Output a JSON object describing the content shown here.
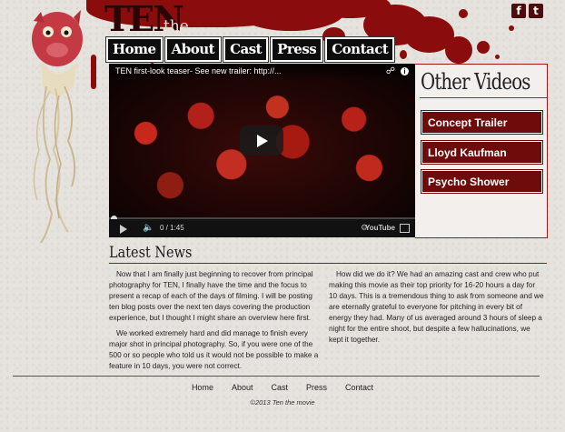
{
  "logo": {
    "ten": "TEN",
    "subtitle": "the movie"
  },
  "social": {
    "facebook": "f",
    "twitter": "t"
  },
  "nav": [
    "Home",
    "About",
    "Cast",
    "Press",
    "Contact"
  ],
  "video": {
    "title": "TEN first-look teaser- See new trailer: http://...",
    "time": "0 / 1:45",
    "logo": "YouTube"
  },
  "other_videos": {
    "heading": "Other Videos",
    "items": [
      "Concept Trailer",
      "Lloyd Kaufman",
      "Psycho Shower"
    ]
  },
  "news": {
    "heading": "Latest News",
    "left": [
      "Now that I am finally just beginning to recover from principal photography for TEN, I finally have the time and the focus to present a recap of each of the days of filming. I will be posting ten blog posts over the next ten days covering the production experience, but I thought I might share an overview here first.",
      "We worked extremely hard and did manage to finish every major shot in principal photography. So, if you were one of the 500 or so people who told us it would not be possible to make a feature in 10 days, you were not correct."
    ],
    "right": [
      "How did we do it? We had an amazing cast and crew who put making this movie as their top priority for 16-20 hours a day for 10 days. This is a tremendous thing to ask from someone and we are eternally grateful to everyone for pitching in every bit of energy they had. Many of us averaged around 3 hours of sleep a night for the entire shoot, but despite a few hallucinations, we kept it together."
    ]
  },
  "footer": {
    "links": [
      "Home",
      "About",
      "Cast",
      "Press",
      "Contact"
    ],
    "copyright": "©2013 Ten the movie"
  },
  "colors": {
    "accent": "#6e0b0b",
    "blood": "#8a0c0c",
    "background": "#e6e3de"
  }
}
